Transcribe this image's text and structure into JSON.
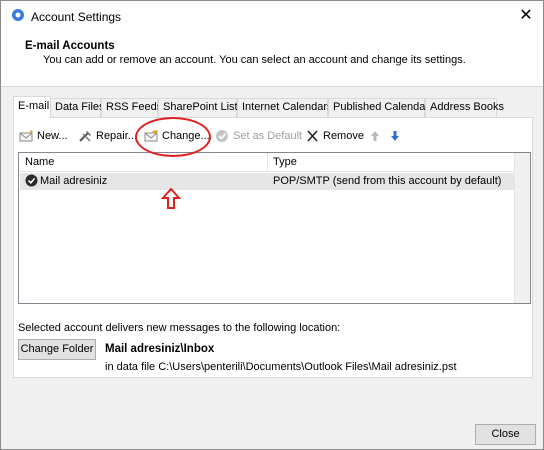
{
  "window": {
    "title": "Account Settings",
    "close_glyph": "✕"
  },
  "header": {
    "title": "E-mail Accounts",
    "description": "You can add or remove an account. You can select an account and change its settings."
  },
  "tabs": [
    {
      "label": "E-mail",
      "active": true
    },
    {
      "label": "Data Files"
    },
    {
      "label": "RSS Feeds"
    },
    {
      "label": "SharePoint Lists"
    },
    {
      "label": "Internet Calendars"
    },
    {
      "label": "Published Calendars"
    },
    {
      "label": "Address Books"
    }
  ],
  "toolbar": {
    "new_label": "New...",
    "repair_label": "Repair...",
    "change_label": "Change...",
    "set_default_label": "Set as Default",
    "remove_label": "Remove"
  },
  "list": {
    "col_name": "Name",
    "col_type": "Type",
    "rows": [
      {
        "name": "Mail adresiniz",
        "type": "POP/SMTP (send from this account by default)"
      }
    ]
  },
  "location": {
    "label": "Selected account delivers new messages to the following location:",
    "change_folder_label": "Change Folder",
    "mailbox": "Mail adresiniz\\Inbox",
    "datafile": "in data file C:\\Users\\penterili\\Documents\\Outlook Files\\Mail adresiniz.pst"
  },
  "footer": {
    "close_label": "Close"
  },
  "colors": {
    "annotation": "#e02020",
    "accent_arrow": "#2f6fd6"
  }
}
